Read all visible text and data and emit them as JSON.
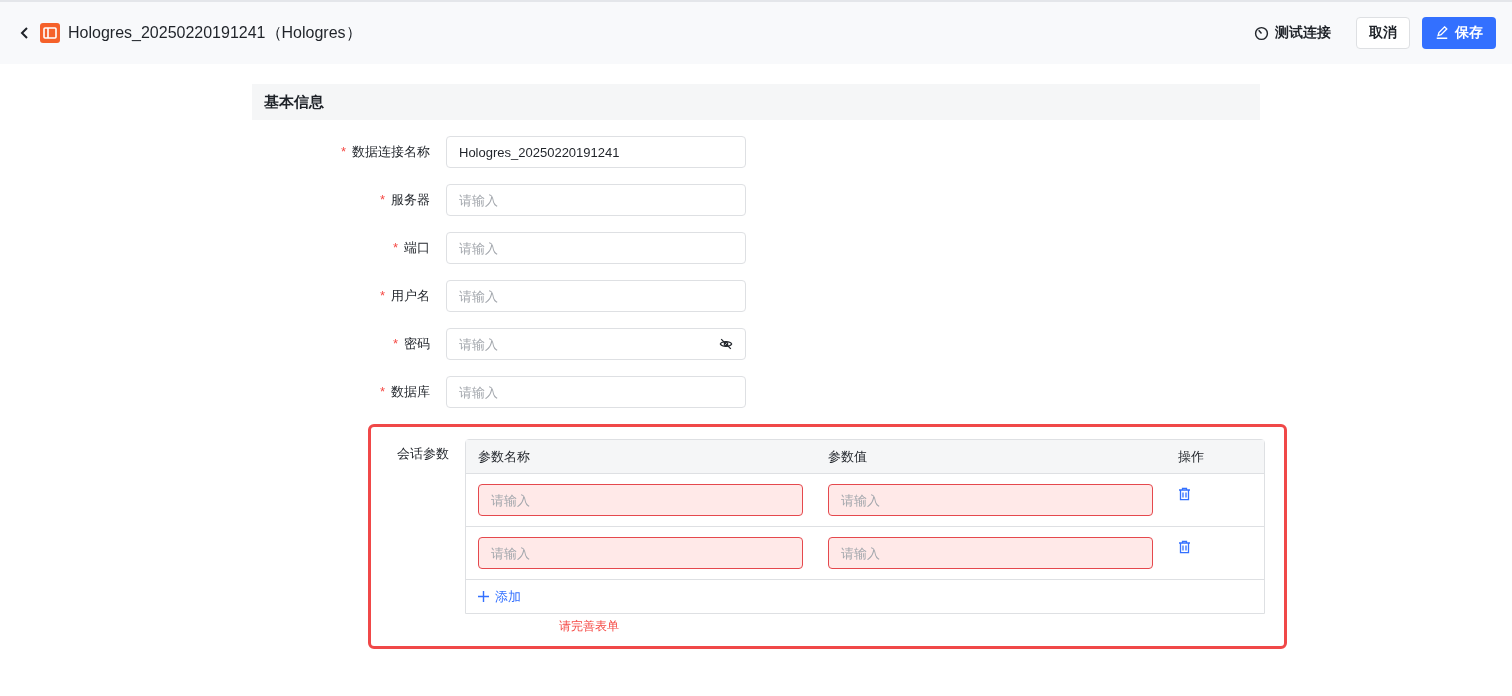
{
  "header": {
    "title": "Hologres_20250220191241（Hologres）",
    "actions": [
      {
        "kind": "test",
        "label": "测试连接"
      },
      {
        "kind": "default",
        "label": "取消"
      },
      {
        "kind": "primary",
        "label": "保存"
      }
    ]
  },
  "section": {
    "title": "基本信息"
  },
  "fields": [
    {
      "label": "数据连接名称",
      "required_mark": "*",
      "kind": "text",
      "value": "Hologres_20250220191241"
    },
    {
      "label": "服务器",
      "required_mark": "*",
      "kind": "text",
      "placeholder": "请输入"
    },
    {
      "label": "端口",
      "required_mark": "*",
      "kind": "text",
      "placeholder": "请输入"
    },
    {
      "label": "用户名",
      "required_mark": "*",
      "kind": "text",
      "placeholder": "请输入"
    },
    {
      "label": "密码",
      "required_mark": "*",
      "kind": "password",
      "placeholder": "请输入"
    },
    {
      "label": "数据库",
      "required_mark": "*",
      "kind": "text",
      "placeholder": "请输入"
    }
  ],
  "session_params": {
    "label": "会话参数",
    "highlighted": true,
    "columns": [
      "参数名称",
      "参数值",
      "操作"
    ],
    "rows": [
      {
        "name": {
          "placeholder": "请输入",
          "error": true
        },
        "value": {
          "placeholder": "请输入",
          "error": true
        }
      },
      {
        "name": {
          "placeholder": "请输入",
          "error": true
        },
        "value": {
          "placeholder": "请输入",
          "error": true
        }
      }
    ],
    "add_label": "添加",
    "error_message": "请完善表单"
  }
}
